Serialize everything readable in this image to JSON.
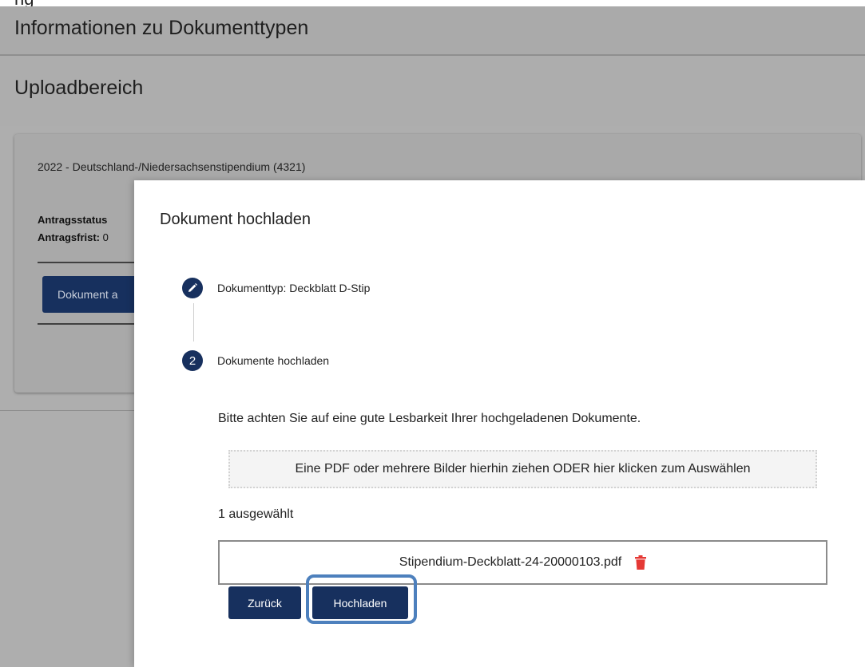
{
  "header": {
    "cut_text": "ng"
  },
  "sections": {
    "doc_types_title": "Informationen zu Dokumenttypen",
    "upload_area_title": "Uploadbereich"
  },
  "card": {
    "title": "2022 - Deutschland-/Niedersachsenstipendium (4321)",
    "status_label": "Antragsstatus",
    "deadline_label": "Antragsfrist:",
    "deadline_value": "0",
    "button_label": "Dokument a"
  },
  "dialog": {
    "title": "Dokument hochladen",
    "steps": [
      {
        "icon": "pencil-icon",
        "label": "Dokumenttyp: Deckblatt D-Stip"
      },
      {
        "number": "2",
        "label": "Dokumente hochladen"
      }
    ],
    "hint": "Bitte achten Sie auf eine gute Lesbarkeit Ihrer hochgeladenen Dokumente.",
    "dropzone_text": "Eine PDF oder mehrere Bilder hierhin ziehen ODER hier klicken zum Auswählen",
    "selected_count": "1 ausgewählt",
    "file": {
      "name": "Stipendium-Deckblatt-24-20000103.pdf",
      "delete_icon": "trash-icon"
    },
    "back_label": "Zurück",
    "upload_label": "Hochladen"
  },
  "colors": {
    "primary": "#17305e",
    "overlay": "#aeaeae",
    "delete": "#e53935",
    "highlight": "#4d80bd"
  }
}
